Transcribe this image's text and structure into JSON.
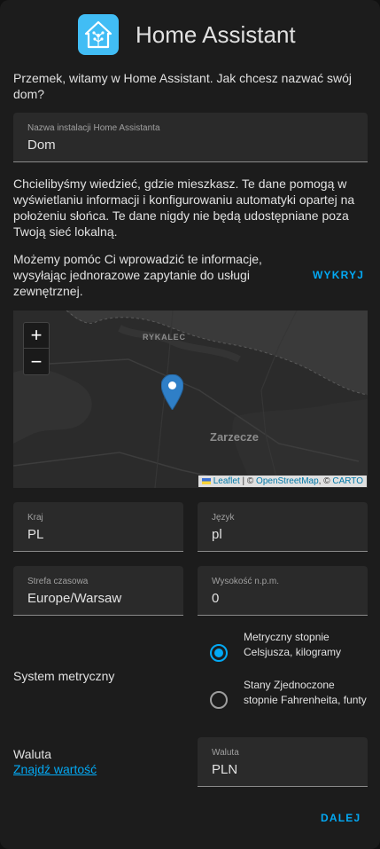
{
  "header": {
    "title": "Home Assistant"
  },
  "intro": "Przemek, witamy w Home Assistant. Jak chcesz nazwać swój dom?",
  "name_field": {
    "label": "Nazwa instalacji Home Assistanta",
    "value": "Dom"
  },
  "location_text": "Chcielibyśmy wiedzieć, gdzie mieszkasz. Te dane pomogą w wyświetlaniu informacji i konfigurowaniu automatyki opartej na położeniu słońca. Te dane nigdy nie będą udostępniane poza Twoją sieć lokalną.",
  "detect_text": "Możemy pomóc Ci wprowadzić te informacje, wysyłając jednorazowe zapytanie do usługi zewnętrznej.",
  "detect_button": "WYKRYJ",
  "map": {
    "zoom_in": "+",
    "zoom_out": "−",
    "label_rykalec": "RYKALEC",
    "label_zarzecze": "Zarzecze",
    "attribution": {
      "leaflet": "Leaflet",
      "sep1": " | © ",
      "osm": "OpenStreetMap",
      "sep2": ", © ",
      "carto": "CARTO"
    }
  },
  "country": {
    "label": "Kraj",
    "value": "PL"
  },
  "language": {
    "label": "Język",
    "value": "pl"
  },
  "timezone": {
    "label": "Strefa czasowa",
    "value": "Europe/Warsaw"
  },
  "elevation": {
    "label": "Wysokość n.p.m.",
    "value": "0"
  },
  "unit_system": {
    "label": "System metryczny",
    "metric": "Metryczny stopnie Celsjusza, kilogramy",
    "imperial": "Stany Zjednoczone stopnie Fahrenheita, funty",
    "selected": "metric"
  },
  "currency": {
    "label": "Waluta",
    "link": "Znajdź wartość",
    "field_label": "Waluta",
    "value": "PLN"
  },
  "next_button": "DALEJ",
  "colors": {
    "accent": "#03a9f4",
    "logo": "#41bdf5",
    "background": "#1c1c1c",
    "field": "#2a2a2a",
    "marker": "#2f7fc7"
  }
}
